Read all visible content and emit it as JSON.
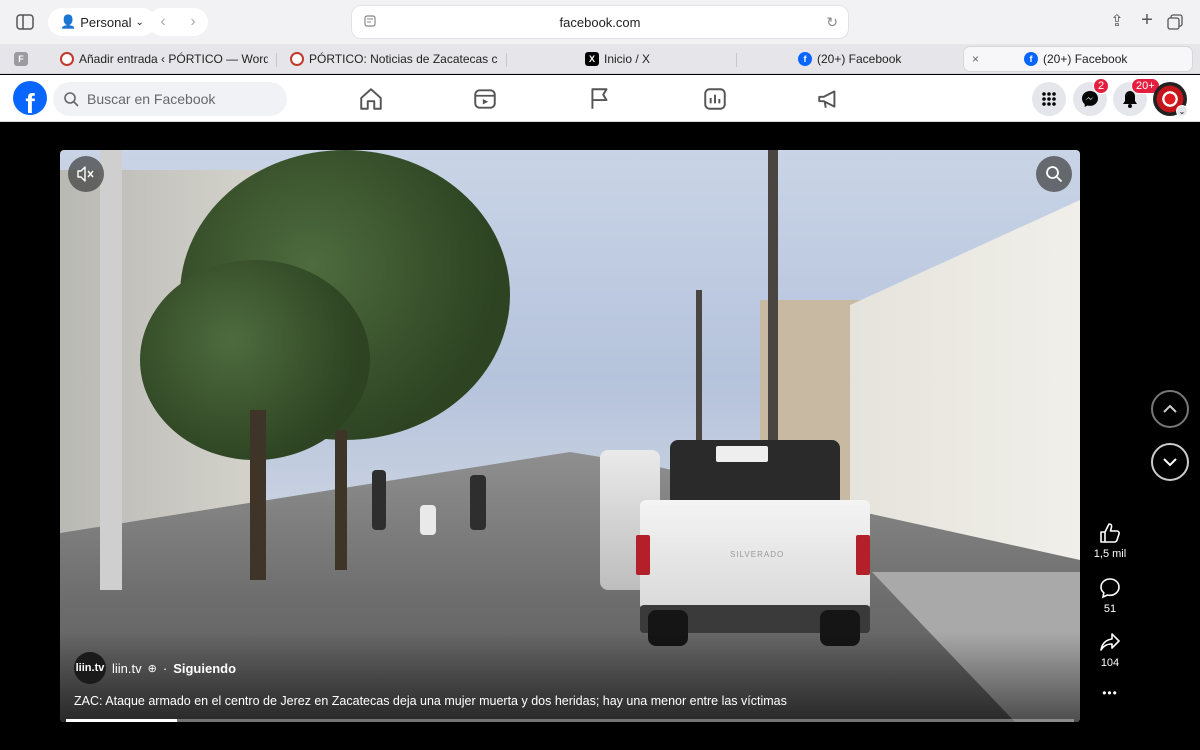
{
  "browser": {
    "profile_label": "Personal",
    "url": "facebook.com",
    "tabs": [
      {
        "label": "Añadir entrada ‹ PÓRTICO — Word..."
      },
      {
        "label": "PÓRTICO: Noticias de Zacatecas c..."
      },
      {
        "label": "Inicio / X"
      },
      {
        "label": "(20+) Facebook"
      },
      {
        "label": "(20+) Facebook"
      }
    ],
    "pinned_tab_letter": "F"
  },
  "facebook": {
    "search_placeholder": "Buscar en Facebook",
    "messenger_badge": "2",
    "notifications_badge": "20+",
    "brand_color": "#0866ff"
  },
  "video": {
    "author_avatar_text": "liin.tv",
    "author_name": "liin.tv",
    "separator": "·",
    "follow_status": "Siguiendo",
    "caption": "ZAC: Ataque armado en el centro de Jerez en Zacatecas deja una mujer muerta y dos heridas; hay una menor entre las víctimas",
    "progress_fraction": 0.11,
    "truck_plate_text": "SILVERADO"
  },
  "actions": {
    "likes": "1,5 mil",
    "comments": "51",
    "shares": "104",
    "more": "•••"
  }
}
